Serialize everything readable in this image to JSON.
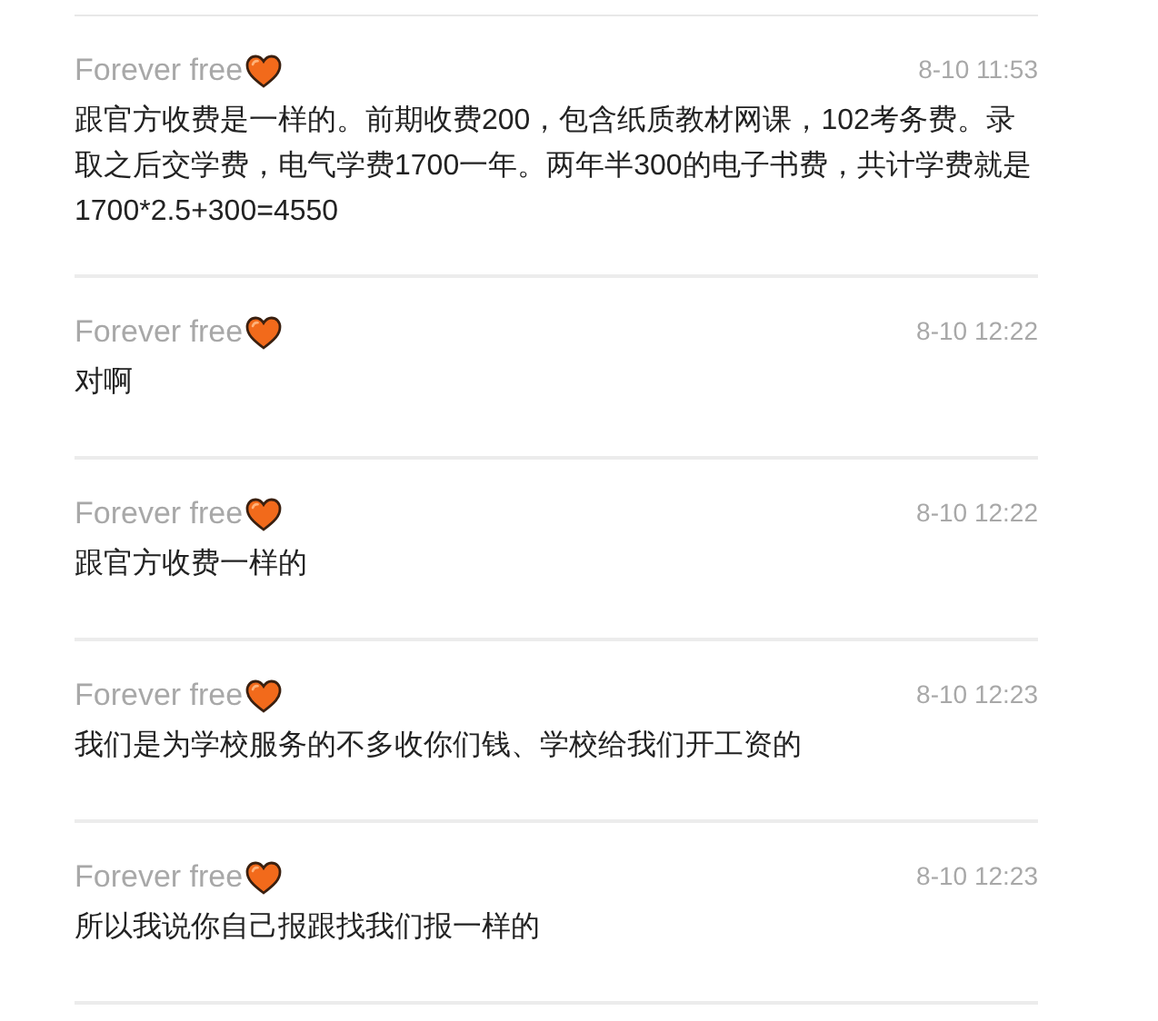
{
  "comments": [
    {
      "author": "Forever free",
      "time": "8-10 11:53",
      "text": "跟官方收费是一样的。前期收费200，包含纸质教材网课，102考务费。录取之后交学费，电气学费1700一年。两年半300的电子书费，共计学费就是1700*2.5+300=4550"
    },
    {
      "author": "Forever free",
      "time": "8-10 12:22",
      "text": "对啊"
    },
    {
      "author": "Forever free",
      "time": "8-10 12:22",
      "text": "跟官方收费一样的"
    },
    {
      "author": "Forever free",
      "time": "8-10 12:23",
      "text": "我们是为学校服务的不多收你们钱、学校给我们开工资的"
    },
    {
      "author": "Forever free",
      "time": "8-10 12:23",
      "text": "所以我说你自己报跟找我们报一样的"
    }
  ]
}
